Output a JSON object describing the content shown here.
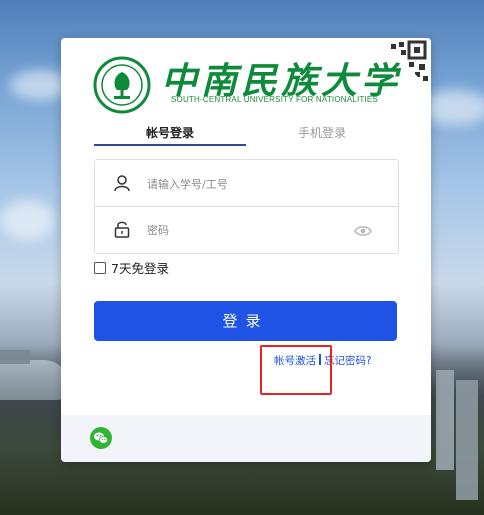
{
  "colors": {
    "brand_green": "#0d8a3a",
    "primary_blue": "#1e53e5",
    "highlight_red": "#e52424",
    "tab_underline": "#2d4a8c"
  },
  "university": {
    "name_cn": "中南民族大学",
    "name_en": "SOUTH-CENTRAL UNIVERSITY FOR NATIONALITIES"
  },
  "tabs": [
    {
      "label": "帐号登录",
      "active": true
    },
    {
      "label": "手机登录",
      "active": false
    }
  ],
  "form": {
    "username": {
      "placeholder": "请输入学号/工号",
      "value": "",
      "icon": "user-icon"
    },
    "password": {
      "placeholder": "密码",
      "value": "",
      "icon": "lock-icon",
      "toggle_icon": "eye-icon"
    },
    "remember_label": "7天免登录",
    "remember_checked": false,
    "login_label": "登录"
  },
  "links": {
    "activate": "帐号激活",
    "forgot": "忘记密码?"
  },
  "footer": {
    "icon": "wechat-icon"
  },
  "icons": {
    "qr_corner": "qr-code-icon",
    "logo": "university-emblem-icon"
  }
}
